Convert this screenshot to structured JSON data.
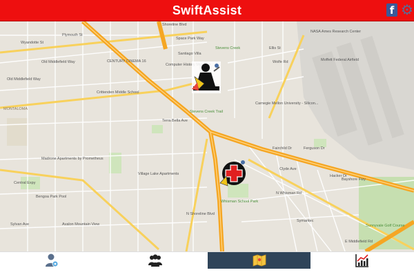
{
  "app": {
    "title": "SwiftAssist",
    "facebook_glyph": "f"
  },
  "colors": {
    "header": "#ee0f0f",
    "nav_active": "#2f4459",
    "freeway": "#f5a623",
    "major_road": "#f8d15c"
  },
  "map": {
    "markers": [
      {
        "name": "roadside-assistance-marker",
        "icon": "tow-service-icon"
      },
      {
        "name": "medical-emergency-marker",
        "icon": "first-aid-cross-icon"
      }
    ],
    "labels": {
      "l1": "Plymouth St",
      "l2": "Wyandotte St",
      "l3": "Old Middlefield Way",
      "l4": "Old Middlefield Way",
      "l5": "Shoreline Blvd",
      "l6": "Space Park Way",
      "l7": "Santiago Villa",
      "l8": "CENTURY CINEMA 16",
      "l9": "Computer History Museum",
      "l10": "Crittenden Middle School",
      "l11": "Terra Bella Ave",
      "l12": "Stevens Creek Trail",
      "l13": "MONTALOMA",
      "l14": "Madrone Apartments by Prometheus",
      "l15": "Bengoa Park Pool",
      "l16": "Avalon Mountain View",
      "l17": "Village Lake Apartments",
      "l18": "Carnegie Mellon University - Silicon...",
      "l19": "NASA Ames Research Center",
      "l20": "Moffett Federal Airfield",
      "l21": "Ellis St",
      "l22": "Wolfe Rd",
      "l23": "E Middlefield Rd",
      "l24": "Whisman School Park",
      "l25": "Bayshore Fwy",
      "l26": "Hacker Dr",
      "l27": "Sunnyvale Golf Course",
      "l28": "Symantec",
      "l29": "Sylvan Ave",
      "l30": "N Whisman Rd",
      "l31": "Fairchild Dr",
      "l32": "Clyde Ave",
      "l33": "Ferguson Dr",
      "l34": "N Shoreline Blvd",
      "l35": "Central Expy",
      "l36": "Stevens Creek"
    }
  },
  "nav": {
    "items": [
      {
        "name": "nav-account",
        "icon": "user-settings-icon"
      },
      {
        "name": "nav-community",
        "icon": "group-icon"
      },
      {
        "name": "nav-map",
        "icon": "map-icon",
        "active": true
      },
      {
        "name": "nav-stats",
        "icon": "line-chart-icon"
      }
    ]
  }
}
